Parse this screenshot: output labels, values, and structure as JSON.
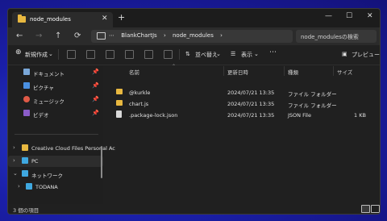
{
  "window": {
    "tab_title": "node_modules",
    "tab_close": "✕",
    "new_tab": "+",
    "controls": [
      "—",
      "☐",
      "✕"
    ]
  },
  "address": {
    "nav": [
      "←",
      "→",
      "↑",
      "⟳"
    ],
    "more": "⋯",
    "breadcrumbs": [
      "BlankChartJs",
      "›",
      "node_modules",
      "›"
    ],
    "search_placeholder": "node_modulesの検索"
  },
  "toolbar": {
    "new_label": "新規作成",
    "sort_label": "並べ替え",
    "view_label": "表示",
    "more_label": "⋯",
    "preview_label": "プレビュー"
  },
  "sidebar": {
    "quick": [
      {
        "label": "ドキュメント",
        "color": "#7aa7d8"
      },
      {
        "label": "ピクチャ",
        "color": "#4a90e2"
      },
      {
        "label": "ミュージック",
        "color": "#e05a47"
      },
      {
        "label": "ビデオ",
        "color": "#8a5cc8"
      }
    ],
    "tree": [
      {
        "label": "Creative Cloud Files Personal Ac",
        "chev": "›"
      },
      {
        "label": "PC",
        "chev": "›"
      },
      {
        "label": "ネットワーク",
        "chev": "⌄"
      },
      {
        "label": "TODANA",
        "chev": "›"
      }
    ]
  },
  "columns": [
    "名前",
    "更新日時",
    "種類",
    "サイズ"
  ],
  "files": [
    {
      "name": "@kurkle",
      "date": "2024/07/21 13:35",
      "type": "ファイル フォルダー",
      "size": "",
      "icon": "folder"
    },
    {
      "name": "chart.js",
      "date": "2024/07/21 13:35",
      "type": "ファイル フォルダー",
      "size": "",
      "icon": "folder"
    },
    {
      "name": ".package-lock.json",
      "date": "2024/07/21 13:35",
      "type": "JSON File",
      "size": "1 KB",
      "icon": "file"
    }
  ],
  "status": {
    "text": "3 個の項目"
  }
}
